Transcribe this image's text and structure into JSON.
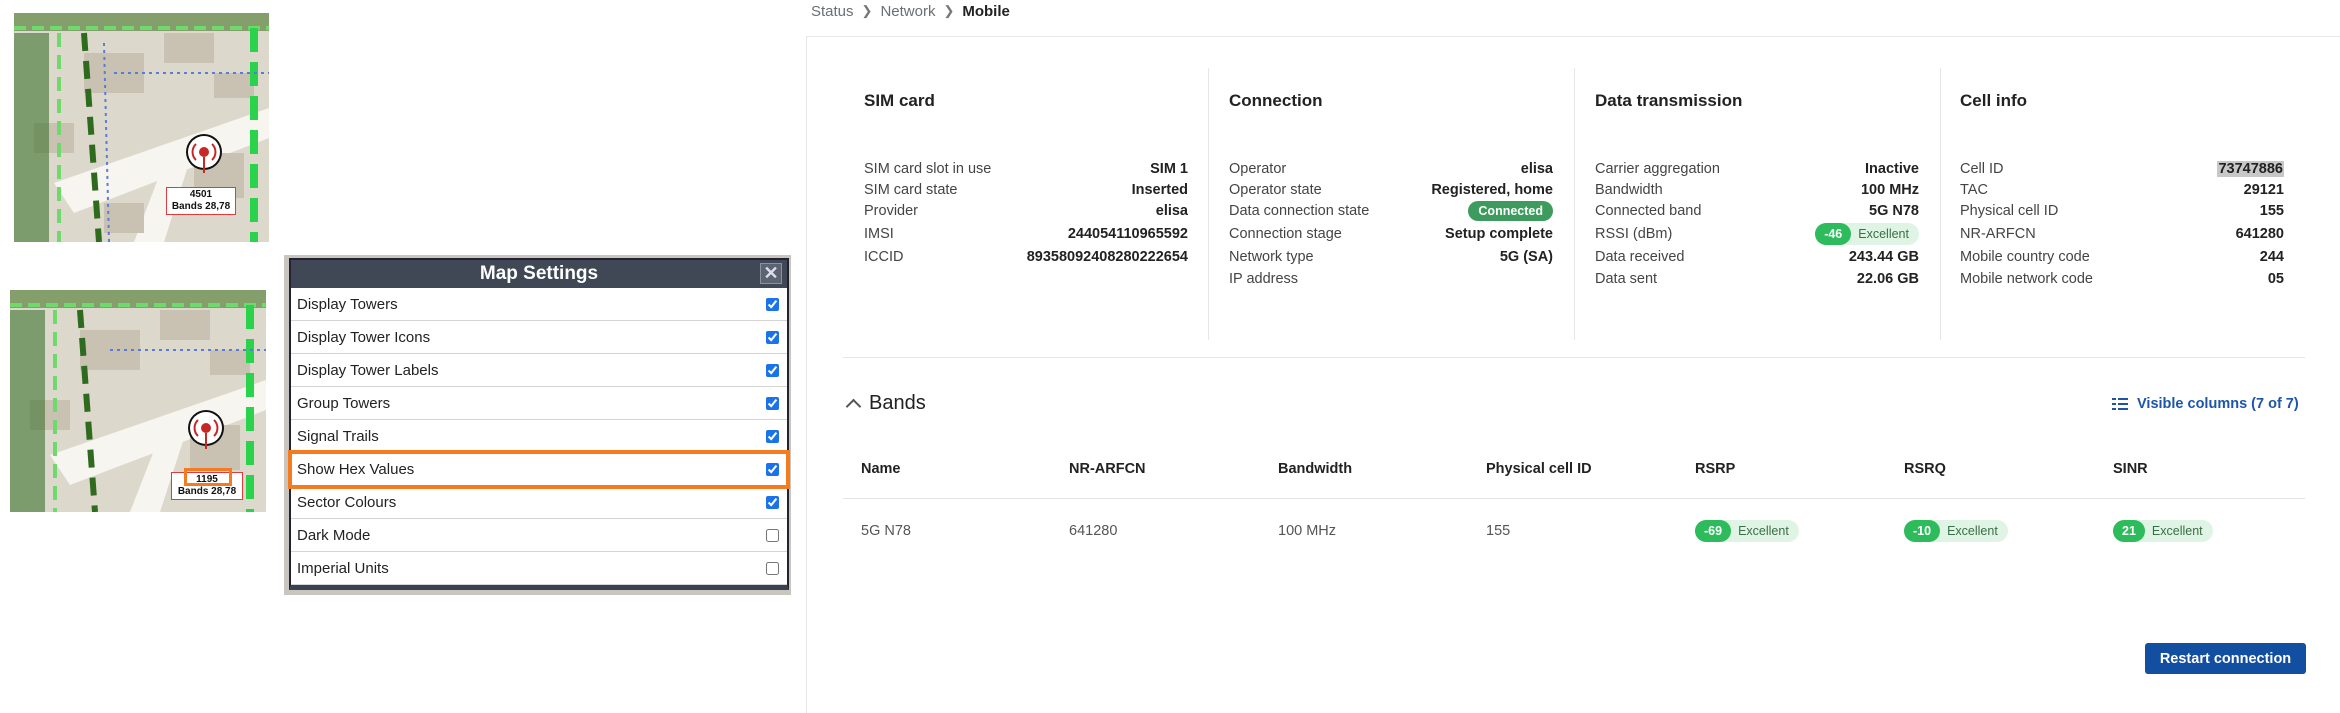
{
  "map_top": {
    "tower_label_line1": "4501",
    "tower_label_line2": "Bands 28,78"
  },
  "map_bottom": {
    "tower_label_line1": "1195",
    "tower_label_line2": "Bands 28,78"
  },
  "map_settings": {
    "title": "Map Settings",
    "close_glyph": "✕",
    "options": [
      {
        "label": "Display Towers",
        "checked": true
      },
      {
        "label": "Display Tower Icons",
        "checked": true
      },
      {
        "label": "Display Tower Labels",
        "checked": true
      },
      {
        "label": "Group Towers",
        "checked": true
      },
      {
        "label": "Signal Trails",
        "checked": true
      },
      {
        "label": "Show Hex Values",
        "checked": true,
        "highlighted": true
      },
      {
        "label": "Sector Colours",
        "checked": true
      },
      {
        "label": "Dark Mode",
        "checked": false
      },
      {
        "label": "Imperial Units",
        "checked": false
      }
    ]
  },
  "breadcrumb": [
    "Status",
    "Network",
    "Mobile"
  ],
  "sim_card": {
    "title": "SIM card",
    "rows": [
      {
        "k": "SIM card slot in use",
        "v": "SIM 1"
      },
      {
        "k": "SIM card state",
        "v": "Inserted"
      },
      {
        "k": "Provider",
        "v": "elisa"
      },
      {
        "k": "IMSI",
        "v": "244054110965592"
      },
      {
        "k": "ICCID",
        "v": "89358092408280222654"
      }
    ]
  },
  "connection": {
    "title": "Connection",
    "rows": [
      {
        "k": "Operator",
        "v": "elisa"
      },
      {
        "k": "Operator state",
        "v": "Registered, home"
      },
      {
        "k": "Data connection state",
        "v": "Connected"
      },
      {
        "k": "Connection stage",
        "v": "Setup complete"
      },
      {
        "k": "Network type",
        "v": "5G (SA)"
      },
      {
        "k": "IP address",
        "v": ""
      }
    ]
  },
  "data_transmission": {
    "title": "Data transmission",
    "rows": [
      {
        "k": "Carrier aggregation",
        "v": "Inactive"
      },
      {
        "k": "Bandwidth",
        "v": "100 MHz"
      },
      {
        "k": "Connected band",
        "v": "5G N78"
      },
      {
        "k": "RSSI (dBm)",
        "v": "-46",
        "quality": "Excellent"
      },
      {
        "k": "Data received",
        "v": "243.44 GB"
      },
      {
        "k": "Data sent",
        "v": "22.06 GB"
      }
    ]
  },
  "cell_info": {
    "title": "Cell info",
    "rows": [
      {
        "k": "Cell ID",
        "v": "73747886"
      },
      {
        "k": "TAC",
        "v": "29121"
      },
      {
        "k": "Physical cell ID",
        "v": "155"
      },
      {
        "k": "NR-ARFCN",
        "v": "641280"
      },
      {
        "k": "Mobile country code",
        "v": "244"
      },
      {
        "k": "Mobile network code",
        "v": "05"
      }
    ]
  },
  "bands": {
    "title": "Bands",
    "visible_columns": "Visible columns (7 of 7)",
    "headers": [
      "Name",
      "NR-ARFCN",
      "Bandwidth",
      "Physical cell ID",
      "RSRP",
      "RSRQ",
      "SINR"
    ],
    "row": {
      "name": "5G N78",
      "nr_arfcn": "641280",
      "bandwidth": "100 MHz",
      "pci": "155",
      "rsrp": "-69",
      "rsrp_q": "Excellent",
      "rsrq": "-10",
      "rsrq_q": "Excellent",
      "sinr": "21",
      "sinr_q": "Excellent"
    }
  },
  "restart_button": "Restart connection",
  "colors": {
    "accent_blue": "#134fa0",
    "good_green": "#2dbb5c",
    "highlight_orange": "#f47b20",
    "panel_dark": "#404856"
  }
}
